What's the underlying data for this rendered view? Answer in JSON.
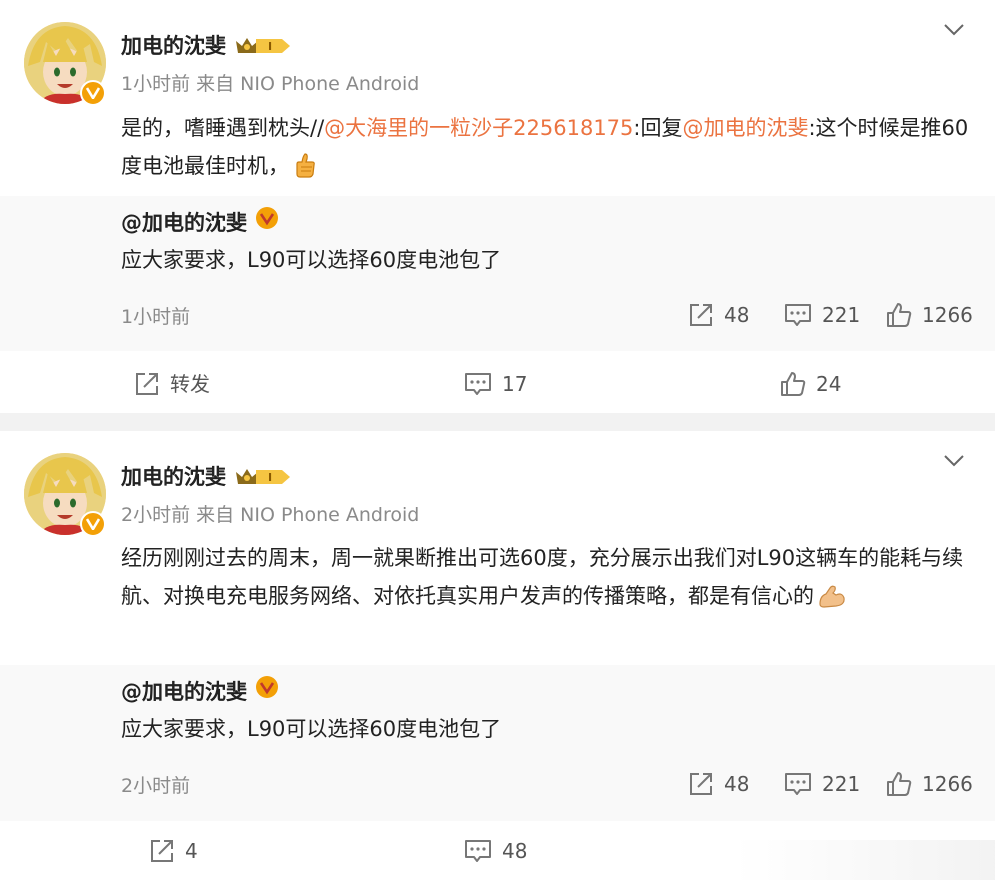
{
  "posts": [
    {
      "author": "加电的沈斐",
      "level": "I",
      "time": "1小时前",
      "source": "来自 NIO Phone Android",
      "text": {
        "p1": "是的，嗜睡遇到枕头//",
        "m1": "@大海里的一粒沙子225618175",
        "p2": ":回复",
        "m2": "@加电的沈斐",
        "p3": ":这个时候是推60度电池最佳时机，"
      },
      "emoji": "thumbs-up",
      "quote": {
        "author": "@加电的沈斐",
        "text": "应大家要求，L90可以选择60度电池包了",
        "time": "1小时前",
        "reposts": "48",
        "comments": "221",
        "likes": "1266"
      },
      "actions": {
        "repost": "转发",
        "comments": "17",
        "likes": "24"
      }
    },
    {
      "author": "加电的沈斐",
      "level": "I",
      "time": "2小时前",
      "source": "来自 NIO Phone Android",
      "text": "经历刚刚过去的周末，周一就果断推出可选60度，充分展示出我们对L90这辆车的能耗与续航、对换电充电服务网络、对依托真实用户发声的传播策略，都是有信心的",
      "emoji": "flexed-biceps",
      "quote": {
        "author": "@加电的沈斐",
        "text": "应大家要求，L90可以选择60度电池包了",
        "time": "2小时前",
        "reposts": "48",
        "comments": "221",
        "likes": "1266"
      },
      "actions": {
        "repost": "4",
        "comments": "48"
      }
    }
  ],
  "icons": [
    "chevron-down-icon",
    "verified-badge-icon",
    "vip-crown-icon",
    "repost-icon",
    "comment-icon",
    "like-icon"
  ],
  "colors": {
    "mention": "#eb7340",
    "verified": "#f3a007",
    "meta": "#8a8a8a",
    "divider": "#f2f2f2"
  }
}
